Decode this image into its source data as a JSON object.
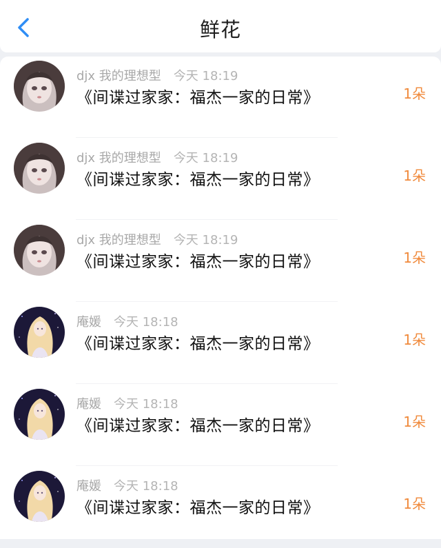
{
  "header": {
    "title": "鲜花",
    "back_icon": "chevron-left-icon",
    "accent_color": "#2f8df5"
  },
  "records": [
    {
      "user": "djx 我的理想型",
      "time": "今天 18:19",
      "book": "《间谍过家家：福杰一家的日常》",
      "count": "1朵",
      "avatar": "girl-portrait-avatar"
    },
    {
      "user": "djx 我的理想型",
      "time": "今天 18:19",
      "book": "《间谍过家家：福杰一家的日常》",
      "count": "1朵",
      "avatar": "girl-portrait-avatar"
    },
    {
      "user": "djx 我的理想型",
      "time": "今天 18:19",
      "book": "《间谍过家家：福杰一家的日常》",
      "count": "1朵",
      "avatar": "girl-portrait-avatar"
    },
    {
      "user": "庵媛",
      "time": "今天 18:18",
      "book": "《间谍过家家：福杰一家的日常》",
      "count": "1朵",
      "avatar": "blonde-girl-avatar"
    },
    {
      "user": "庵媛",
      "time": "今天 18:18",
      "book": "《间谍过家家：福杰一家的日常》",
      "count": "1朵",
      "avatar": "blonde-girl-avatar"
    },
    {
      "user": "庵媛",
      "time": "今天 18:18",
      "book": "《间谍过家家：福杰一家的日常》",
      "count": "1朵",
      "avatar": "blonde-girl-avatar"
    }
  ],
  "colors": {
    "count_color": "#f08a3c",
    "meta_color": "#a8a8a8"
  }
}
